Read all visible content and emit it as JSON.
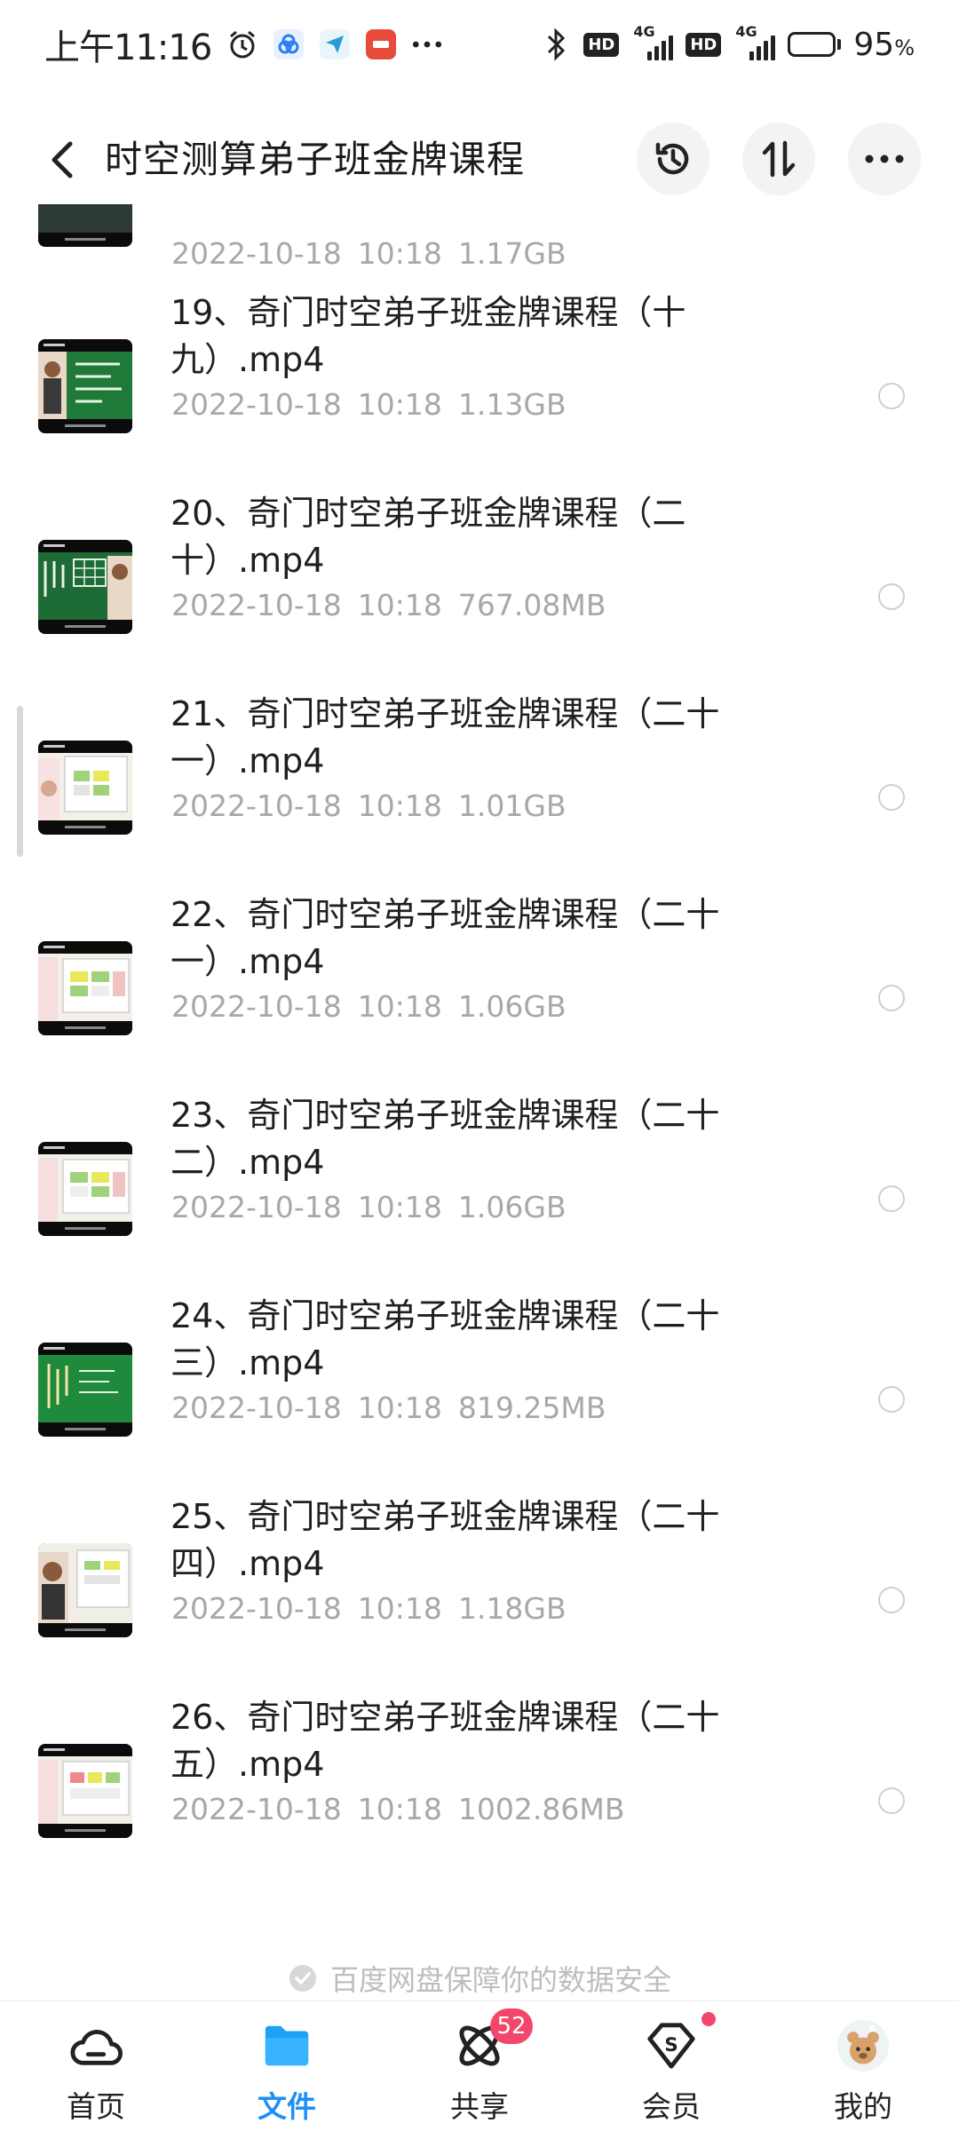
{
  "status_bar": {
    "time": "上午11:16",
    "network_1": "4G",
    "network_2": "4G",
    "hd_1": "HD",
    "hd_2": "HD",
    "battery_percent": "95",
    "battery_unit": "%",
    "battery_level": 0.95
  },
  "header": {
    "title": "时空测算弟子班金牌课程",
    "back_icon": "chevron-left-icon",
    "history_icon": "history-icon",
    "sort_icon": "sort-icon",
    "more_icon": "more-icon"
  },
  "files": [
    {
      "name": "",
      "date": "2022-10-18",
      "time": "10:18",
      "size": "1.17GB",
      "thumb": "partial"
    },
    {
      "name": "19、奇门时空弟子班金牌课程（十九）.mp4",
      "date": "2022-10-18",
      "time": "10:18",
      "size": "1.13GB",
      "thumb": "green-board"
    },
    {
      "name": "20、奇门时空弟子班金牌课程（二十）.mp4",
      "date": "2022-10-18",
      "time": "10:18",
      "size": "767.08MB",
      "thumb": "green-board"
    },
    {
      "name": "21、奇门时空弟子班金牌课程（二十一）.mp4",
      "date": "2022-10-18",
      "time": "10:18",
      "size": "1.01GB",
      "thumb": "slide"
    },
    {
      "name": "22、奇门时空弟子班金牌课程（二十一）.mp4",
      "date": "2022-10-18",
      "time": "10:18",
      "size": "1.06GB",
      "thumb": "slide"
    },
    {
      "name": "23、奇门时空弟子班金牌课程（二十二）.mp4",
      "date": "2022-10-18",
      "time": "10:18",
      "size": "1.06GB",
      "thumb": "slide"
    },
    {
      "name": "24、奇门时空弟子班金牌课程（二十三）.mp4",
      "date": "2022-10-18",
      "time": "10:18",
      "size": "819.25MB",
      "thumb": "green-board"
    },
    {
      "name": "25、奇门时空弟子班金牌课程（二十四）.mp4",
      "date": "2022-10-18",
      "time": "10:18",
      "size": "1.18GB",
      "thumb": "slide"
    },
    {
      "name": "26、奇门时空弟子班金牌课程（二十五）.mp4",
      "date": "2022-10-18",
      "time": "10:18",
      "size": "1002.86MB",
      "thumb": "slide"
    }
  ],
  "footer_note": "百度网盘保障你的数据安全",
  "bottom_nav": [
    {
      "label": "首页",
      "icon": "home-cloud-icon",
      "active": false
    },
    {
      "label": "文件",
      "icon": "folder-icon",
      "active": true
    },
    {
      "label": "共享",
      "icon": "share-atom-icon",
      "active": false,
      "badge": "52"
    },
    {
      "label": "会员",
      "icon": "vip-icon",
      "active": false,
      "dot": true
    },
    {
      "label": "我的",
      "icon": "avatar-icon",
      "active": false
    }
  ],
  "colors": {
    "accent": "#1f8ff7",
    "badge": "#f2466a",
    "meta_text": "#a8a8a8"
  }
}
